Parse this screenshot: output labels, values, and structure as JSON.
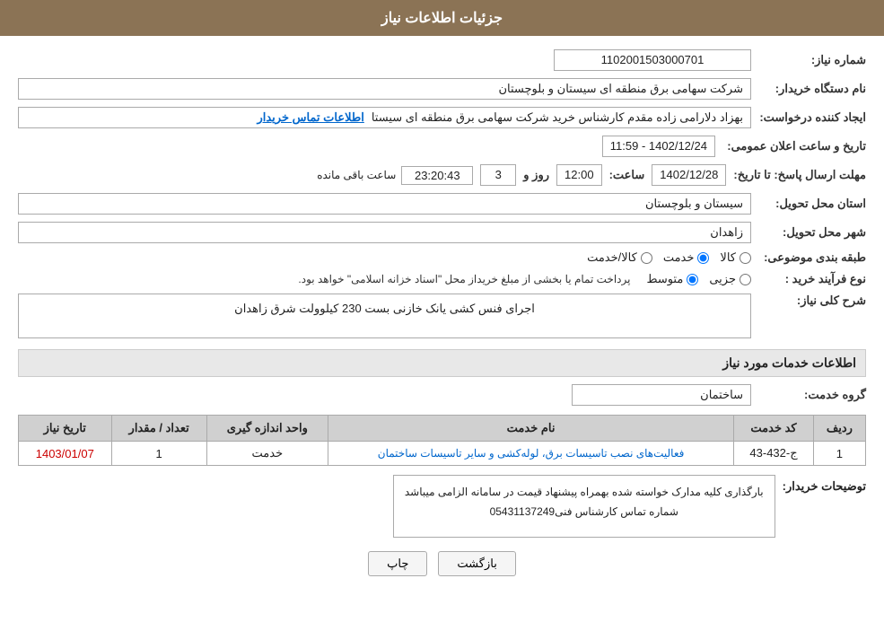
{
  "header": {
    "title": "جزئیات اطلاعات نیاز"
  },
  "fields": {
    "need_number_label": "شماره نیاز:",
    "need_number_value": "1102001503000701",
    "buyer_org_label": "نام دستگاه خریدار:",
    "buyer_org_value": "شرکت سهامی برق منطقه ای سیستان و بلوچستان",
    "creator_label": "ایجاد کننده درخواست:",
    "creator_value": "بهزاد  دلارامی زاده مقدم کارشناس خرید شرکت سهامی برق منطقه ای سیستا",
    "creator_link": "اطلاعات تماس خریدار",
    "announce_datetime_label": "تاریخ و ساعت اعلان عمومی:",
    "announce_date": "1402/12/24",
    "announce_time": "11:59",
    "send_deadline_label": "مهلت ارسال پاسخ: تا تاریخ:",
    "send_date": "1402/12/28",
    "send_time_label": "ساعت:",
    "send_time": "12:00",
    "send_day_label": "روز و",
    "send_days": "3",
    "remaining_label": "ساعت باقی مانده",
    "remaining_time": "23:20:43",
    "province_label": "استان محل تحویل:",
    "province_value": "سیستان و بلوچستان",
    "city_label": "شهر محل تحویل:",
    "city_value": "زاهدان",
    "subject_label": "طبقه بندی موضوعی:",
    "subject_options": [
      {
        "label": "کالا",
        "selected": false
      },
      {
        "label": "خدمت",
        "selected": true
      },
      {
        "label": "کالا/خدمت",
        "selected": false
      }
    ],
    "purchase_type_label": "نوع فرآیند خرید :",
    "purchase_types": [
      {
        "label": "جزیی",
        "selected": false
      },
      {
        "label": "متوسط",
        "selected": true
      }
    ],
    "purchase_desc": "پرداخت تمام یا بخشی از مبلغ خریداز محل \"اسناد خزانه اسلامی\" خواهد بود.",
    "need_description_label": "شرح کلی نیاز:",
    "need_description": "اجرای فنس کشی یانک خازنی بست 230 کیلوولت شرق زاهدان",
    "services_section_title": "اطلاعات خدمات مورد نیاز",
    "service_group_label": "گروه خدمت:",
    "service_group_value": "ساختمان",
    "table": {
      "headers": [
        "ردیف",
        "کد خدمت",
        "نام خدمت",
        "واحد اندازه گیری",
        "تعداد / مقدار",
        "تاریخ نیاز"
      ],
      "rows": [
        {
          "row_num": "1",
          "service_code": "ج-432-43",
          "service_name": "فعالیت‌های نصب تاسیسات برق، لوله‌کشی و سایر تاسیسات ساختمان",
          "unit": "خدمت",
          "quantity": "1",
          "date": "1403/01/07"
        }
      ]
    },
    "buyer_notes_label": "توضیحات خریدار:",
    "buyer_notes_line1": "بارگذاری کلیه مدارک خواسته شده بهمراه پیشنهاد قیمت در سامانه الزامی میباشد",
    "buyer_notes_line2": "شماره تماس کارشناس فنی05431137249"
  },
  "buttons": {
    "print_label": "چاپ",
    "back_label": "بازگشت"
  }
}
